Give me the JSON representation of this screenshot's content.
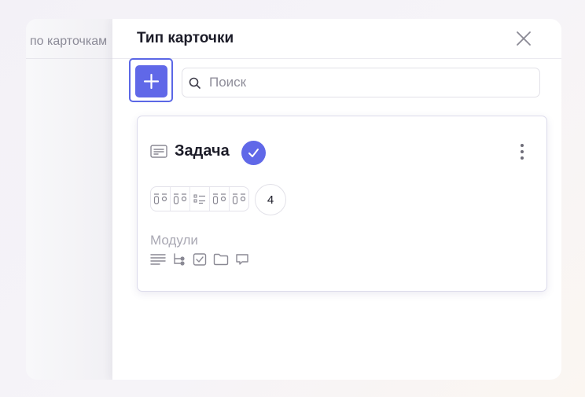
{
  "background_panel": {
    "title": "по карточкам"
  },
  "drawer": {
    "title": "Тип карточки",
    "close_icon": "close-icon",
    "add_icon": "plus-icon",
    "search": {
      "value": "",
      "placeholder": "Поиск",
      "icon": "search-icon"
    }
  },
  "card": {
    "title": "Задача",
    "type_icon": "card-type-icon",
    "selected_icon": "check-icon",
    "menu_icon": "more-vertical-icon",
    "field_icons": [
      "text-field-icon",
      "text-field-icon",
      "list-field-icon",
      "text-field-icon",
      "text-field-icon"
    ],
    "extra_fields_count": "4",
    "modules_label": "Модули",
    "modules": [
      "description-module-icon",
      "subtasks-module-icon",
      "checklist-module-icon",
      "files-module-icon",
      "comments-module-icon"
    ]
  },
  "colors": {
    "accent": "#6068E8",
    "accent_outline": "#5B67E6",
    "muted_text": "#A9A8B3"
  }
}
